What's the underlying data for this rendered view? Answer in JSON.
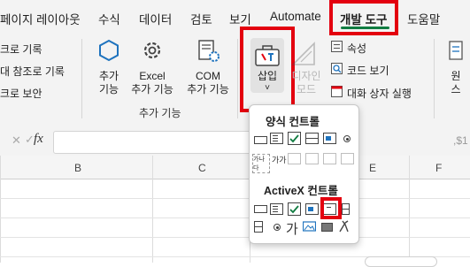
{
  "tabs": [
    {
      "label": "페이지 레이아웃",
      "active": false
    },
    {
      "label": "수식",
      "active": false
    },
    {
      "label": "데이터",
      "active": false
    },
    {
      "label": "검토",
      "active": false
    },
    {
      "label": "보기",
      "active": false
    },
    {
      "label": "Automate",
      "active": false
    },
    {
      "label": "개발 도구",
      "active": true
    },
    {
      "label": "도움말",
      "active": false
    }
  ],
  "ribbon": {
    "code_group": {
      "items": [
        "크로 기록",
        "대 참조로 기록",
        "크로 보안"
      ]
    },
    "addins_group": {
      "title": "추가 기능",
      "addins_button": {
        "line1": "추가",
        "line2": "기능"
      },
      "excel_addins_button": {
        "line1": "Excel",
        "line2": "추가 기능"
      },
      "com_addins_button": {
        "line1": "COM",
        "line2": "추가 기능"
      }
    },
    "controls_group": {
      "insert_button": {
        "label": "삽입",
        "chevron": "˅"
      },
      "design_mode_button": {
        "line1": "디자인",
        "line2": "모드"
      },
      "properties": "속성",
      "view_code": "코드 보기",
      "run_dialog": "대화 상자 실행"
    },
    "source_partial": {
      "line1": "원",
      "line2": "스"
    }
  },
  "formula_bar": {
    "cancel_icon": "✕",
    "confirm_icon": "✓",
    "fx": "fx",
    "value_partial": ",$1"
  },
  "grid": {
    "columns": [
      "B",
      "C",
      "E",
      "F"
    ]
  },
  "dropdown": {
    "form_controls_title": "양식 컨트롤",
    "activex_title": "ActiveX 컨트롤",
    "form_label_glyph": "가나다",
    "form_label2_glyph": "가가",
    "activex_label_glyph": "가"
  },
  "colors": {
    "accent": "#107c41",
    "highlight": "#e3000f"
  }
}
